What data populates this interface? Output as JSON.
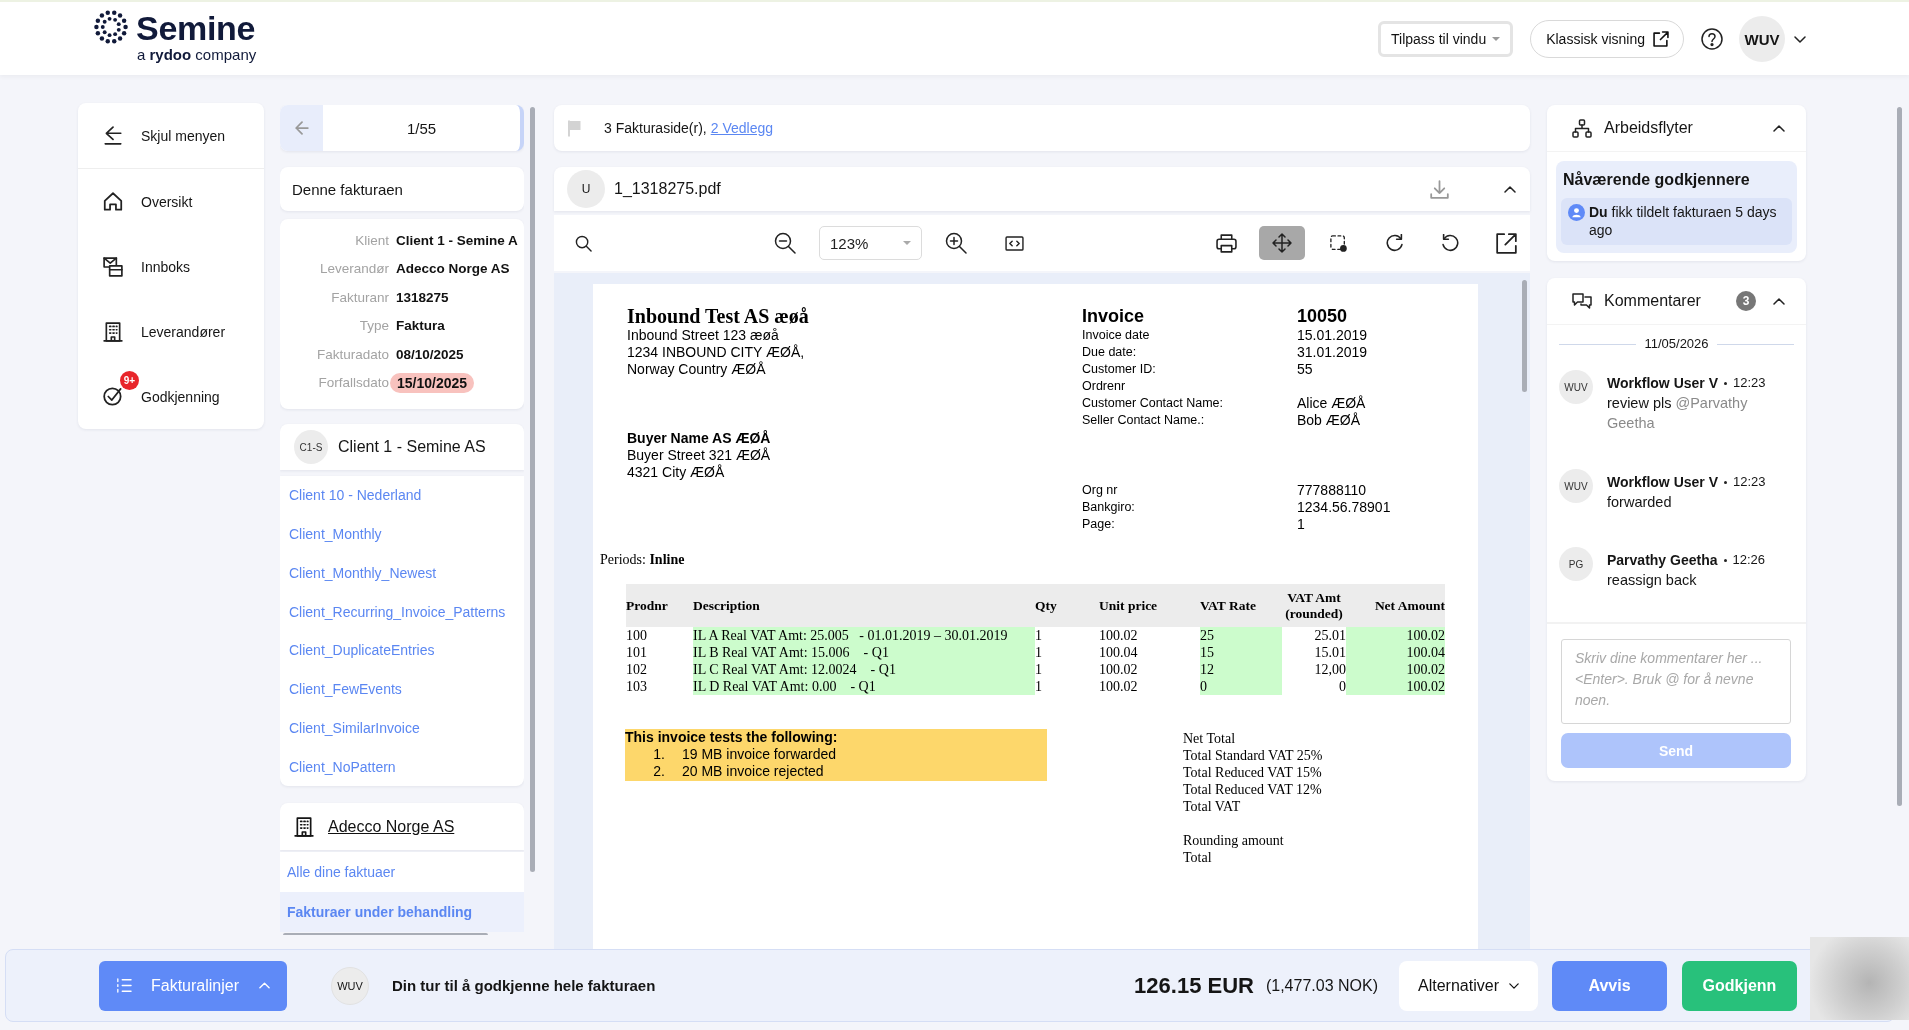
{
  "header": {
    "logo": "Semine",
    "tagline": "a **rydoo** company",
    "fit_select": "Tilpass til vindu",
    "classic_view": "Klassisk visning",
    "user_initials": "WUV"
  },
  "nav": {
    "items": [
      {
        "kind": "collapse",
        "label": "Skjul menyen"
      },
      {
        "kind": "home",
        "label": "Oversikt"
      },
      {
        "kind": "inbox",
        "label": "Innboks"
      },
      {
        "kind": "suppliers",
        "label": "Leverandører"
      },
      {
        "kind": "approval",
        "label": "Godkjenning",
        "badge": "9+"
      }
    ]
  },
  "pager": {
    "position": "1/55"
  },
  "invoice": {
    "title": "Denne fakturaen",
    "fields": [
      {
        "label": "Klient",
        "value": "Client 1 - Semine A",
        "overdue": false
      },
      {
        "label": "Leverandør",
        "value": "Adecco Norge AS",
        "overdue": false
      },
      {
        "label": "Fakturanr",
        "value": "1318275",
        "overdue": false
      },
      {
        "label": "Type",
        "value": "Faktura",
        "overdue": false
      },
      {
        "label": "Fakturadato",
        "value": "08/10/2025",
        "overdue": false
      },
      {
        "label": "Forfallsdato",
        "value": "15/10/2025",
        "overdue": true
      }
    ]
  },
  "client": {
    "initials": "C1-S",
    "name": "Client 1 - Semine AS",
    "items": [
      "Client 10 - Nederland",
      "Client_Monthly",
      "Client_Monthly_Newest",
      "Client_Recurring_Invoice_Patterns",
      "Client_DuplicateEntries",
      "Client_FewEvents",
      "Client_SimilarInvoice",
      "Client_NoPattern"
    ]
  },
  "supplier": {
    "name": "Adecco Norge AS",
    "items": [
      {
        "label": "Alle dine faktuaer",
        "selected": false
      },
      {
        "label": "Fakturaer under behandling",
        "selected": true
      }
    ]
  },
  "attachments": {
    "pages": "3 Fakturaside(r),",
    "link": "2 Vedlegg"
  },
  "document": {
    "initial": "U",
    "filename": "1_1318275.pdf"
  },
  "toolbar": {
    "zoom": "123%",
    "tools": [
      {
        "kind": "print",
        "selected": false
      },
      {
        "kind": "pan",
        "selected": true
      },
      {
        "kind": "select-area",
        "selected": false
      },
      {
        "kind": "rotate-right",
        "selected": false
      },
      {
        "kind": "rotate-left",
        "selected": false
      },
      {
        "kind": "open-external",
        "selected": false
      }
    ]
  },
  "pdf_page": {
    "seller_name": "Inbound Test AS æøå",
    "seller_address": [
      "Inbound Street 123 æøå",
      "1234 INBOUND CITY ÆØÅ,",
      "Norway Country ÆØÅ"
    ],
    "buyer_name": "Buyer Name AS ÆØÅ",
    "buyer_address": [
      "Buyer Street 321 ÆØÅ",
      "4321 City ÆØÅ"
    ],
    "title": "Invoice",
    "number": "10050",
    "details": [
      {
        "label": "Invoice date",
        "value": "15.01.2019"
      },
      {
        "label": "Due date:",
        "value": "31.01.2019"
      },
      {
        "label": "Customer ID:",
        "value": "55"
      },
      {
        "label": "Ordrenr"
      },
      {
        "label": "Customer Contact Name:",
        "value": "Alice ÆØÅ"
      },
      {
        "label": "Seller Contact Name.:",
        "value": "Bob ÆØÅ"
      }
    ],
    "payment": [
      {
        "label": "Org nr",
        "value": "777888110"
      },
      {
        "label": "Bankgiro:",
        "value": "1234.56.78901"
      },
      {
        "label": "Page:",
        "value": "1"
      }
    ],
    "periods": "Periods: **Inline**",
    "table": {
      "columns": [
        {
          "label": "Prodnr",
          "highlighted": false
        },
        {
          "label": "Description",
          "highlighted": true
        },
        {
          "label": "Qty",
          "highlighted": false
        },
        {
          "label": "Unit price",
          "highlighted": false
        },
        {
          "label": "VAT Rate",
          "highlighted": true
        },
        {
          "label": "VAT Amt (rounded)",
          "highlighted": false
        },
        {
          "label": "Net Amount",
          "highlighted": true
        }
      ],
      "rows": [
        [
          "100",
          "IL A Real VAT Amt: 25.005   - 01.01.2019 – 30.01.2019",
          "1",
          "100.02",
          "25",
          "25.01",
          "100.02"
        ],
        [
          "101",
          "IL B Real VAT Amt: 15.006    - Q1",
          "1",
          "100.04",
          "15",
          "15.01",
          "100.04"
        ],
        [
          "102",
          "IL C Real VAT Amt: 12.0024    - Q1",
          "1",
          "100.02",
          "12",
          "12,00",
          "100.02"
        ],
        [
          "103",
          "IL D Real VAT Amt: 0.00    - Q1",
          "1",
          "100.02",
          "0",
          "0",
          "100.02"
        ]
      ]
    },
    "note": {
      "title": "This invoice tests the following:",
      "items": [
        {
          "number": "1.",
          "text": "19 MB invoice forwarded"
        },
        {
          "number": "2.",
          "text": "20 MB invoice rejected"
        }
      ]
    },
    "totals": [
      [
        "Net Total",
        "Total Standard VAT 25%",
        "Total Reduced VAT 15%",
        "Total Reduced VAT 12%",
        "Total VAT"
      ],
      [
        "Rounding amount",
        "Total"
      ]
    ]
  },
  "workflows": {
    "title": "Arbeidsflyter",
    "current_title": "Nåværende godkjennere",
    "assignment": "**Du** fikk tildelt fakturaen 5 days ago"
  },
  "comments": {
    "title": "Kommentarer",
    "count": "3",
    "date": "11/05/2026",
    "items": [
      {
        "initials": "WUV",
        "author": "Workflow User V",
        "time": "12:23",
        "text": "review pls",
        "mention": "@Parvathy Geetha"
      },
      {
        "initials": "WUV",
        "author": "Workflow User V",
        "time": "12:23",
        "text": "forwarded"
      },
      {
        "initials": "PG",
        "author": "Parvathy Geetha",
        "time": "12:26",
        "text": "reassign back"
      }
    ],
    "placeholder": "Skriv dine kommentarer her ... <Enter>. Bruk @ for å nevne noen.",
    "send": {
      "label": "Send",
      "disabled": true
    }
  },
  "action_bar": {
    "lines_button": "Fakturalinjer",
    "initials": "WUV",
    "message": "Din tur til å godkjenne hele fakturaen",
    "amount": "126.15 EUR",
    "converted": "(1,477.03 NOK)",
    "options": "Alternativer",
    "reject": "Avvis",
    "approve": "Godkjenn"
  }
}
